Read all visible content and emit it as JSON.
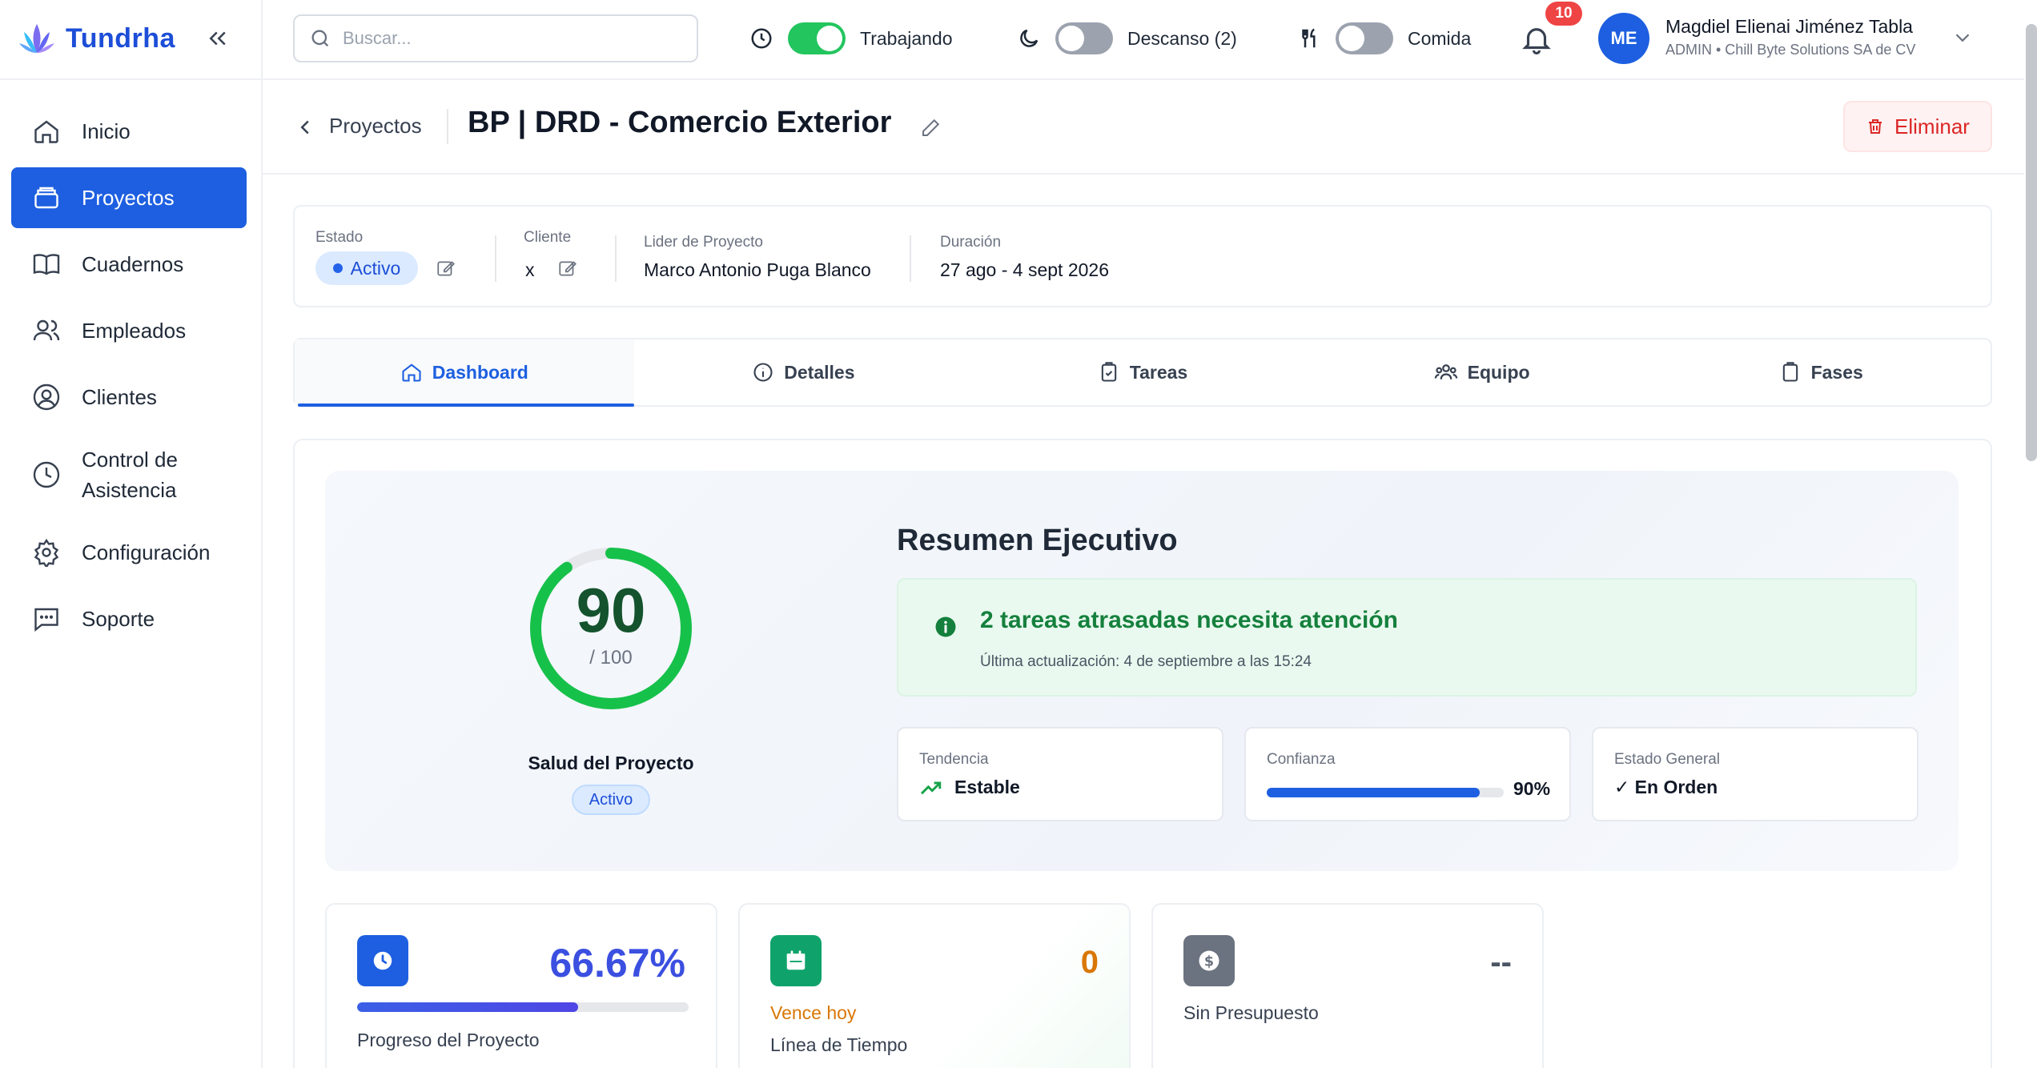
{
  "app": {
    "name": "Tundrha"
  },
  "sidebar": {
    "items": [
      {
        "label": "Inicio",
        "icon": "home-icon"
      },
      {
        "label": "Proyectos",
        "icon": "folder-icon"
      },
      {
        "label": "Cuadernos",
        "icon": "book-icon"
      },
      {
        "label": "Empleados",
        "icon": "users-icon"
      },
      {
        "label": "Clientes",
        "icon": "user-circle-icon"
      },
      {
        "label": "Control de Asistencia",
        "icon": "clock-icon"
      },
      {
        "label": "Configuración",
        "icon": "gear-icon"
      },
      {
        "label": "Soporte",
        "icon": "chat-icon"
      }
    ],
    "active_index": 1
  },
  "topbar": {
    "search_placeholder": "Buscar...",
    "working_label": "Trabajando",
    "break_label": "Descanso (2)",
    "meal_label": "Comida",
    "working_on": true,
    "break_on": false,
    "meal_on": false,
    "notifications_count": "10",
    "user": {
      "initials": "ME",
      "name": "Magdiel Elienai Jiménez Tabla",
      "subtitle": "ADMIN • Chill Byte Solutions SA de CV"
    }
  },
  "page": {
    "breadcrumb": "Proyectos",
    "title": "BP | DRD - Comercio Exterior",
    "delete_label": "Eliminar"
  },
  "info": {
    "estado_label": "Estado",
    "estado_value": "Activo",
    "cliente_label": "Cliente",
    "cliente_value": "x",
    "lider_label": "Lider de Proyecto",
    "lider_value": "Marco Antonio Puga Blanco",
    "duracion_label": "Duración",
    "duracion_value": "27 ago - 4 sept 2026"
  },
  "tabs": [
    {
      "label": "Dashboard",
      "icon": "home-icon"
    },
    {
      "label": "Detalles",
      "icon": "info-icon"
    },
    {
      "label": "Tareas",
      "icon": "clipboard-check-icon"
    },
    {
      "label": "Equipo",
      "icon": "team-icon"
    },
    {
      "label": "Fases",
      "icon": "clipboard-icon"
    }
  ],
  "summary": {
    "health_score": "90",
    "health_max": "/ 100",
    "health_fraction": 0.9,
    "health_label": "Salud del Proyecto",
    "health_status": "Activo",
    "title": "Resumen Ejecutivo",
    "alert_title": "2 tareas atrasadas necesita atención",
    "alert_updated": "Última actualización: 4 de septiembre a las 15:24",
    "trend_label": "Tendencia",
    "trend_value": "Estable",
    "confidence_label": "Confianza",
    "confidence_value": "90%",
    "confidence_fraction": 0.9,
    "general_label": "Estado General",
    "general_value": "✓ En Orden"
  },
  "kpis": {
    "progress_value": "66.67%",
    "progress_fraction": 0.6667,
    "progress_label": "Progreso del Proyecto",
    "due_value": "0",
    "due_status": "Vence hoy",
    "due_label": "Línea de Tiempo",
    "budget_value": "--",
    "budget_label": "Sin Presupuesto"
  },
  "colors": {
    "primary": "#1d5fe0",
    "success": "#16a34a",
    "danger": "#dc2626",
    "warning": "#d97706"
  }
}
